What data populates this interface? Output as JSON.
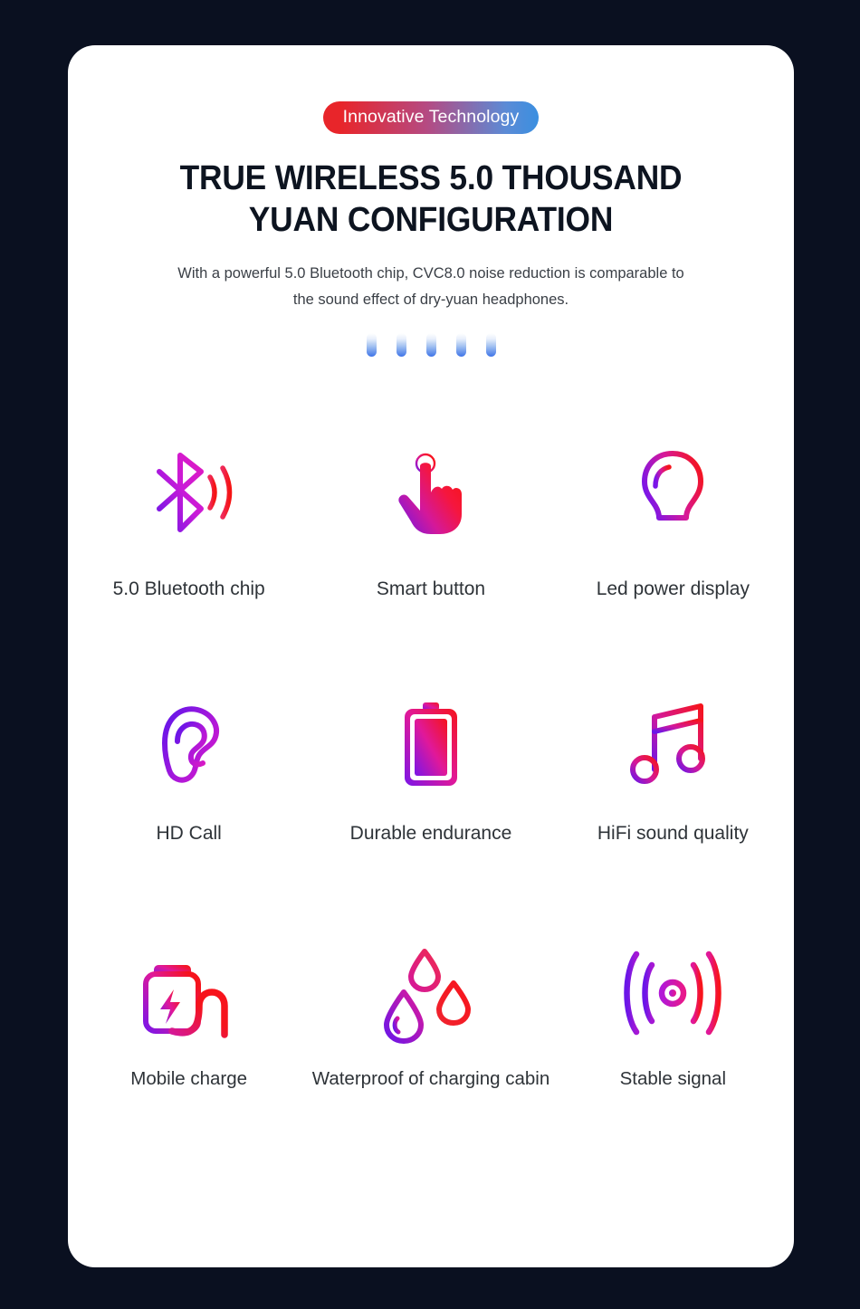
{
  "page": {
    "background_color": "#0a1020",
    "card_background": "#ffffff"
  },
  "badge": {
    "label": "Innovative Technology",
    "gradient_from": "#e8252a",
    "gradient_to": "#3a8fe0",
    "text_color": "#ffffff"
  },
  "headline": {
    "line1": "TRUE WIRELESS 5.0 THOUSAND",
    "line2": "YUAN CONFIGURATION",
    "color": "#0d1420"
  },
  "subcopy": {
    "text": "With a powerful 5.0 Bluetooth chip, CVC8.0 noise reduction is comparable to the sound effect of dry-yuan headphones.",
    "color": "#3a3f46"
  },
  "divider_bars": {
    "count": 5,
    "gradient_from": "#ffffff",
    "gradient_to": "#3f74e8"
  },
  "features": {
    "rows": [
      {
        "cells": [
          {
            "icon": "bluetooth-signal-icon",
            "label": "5.0 Bluetooth chip"
          },
          {
            "icon": "tap-hand-icon",
            "label": "Smart button"
          },
          {
            "icon": "lightbulb-icon",
            "label": "Led power display"
          }
        ]
      },
      {
        "cells": [
          {
            "icon": "ear-icon",
            "label": "HD Call"
          },
          {
            "icon": "battery-icon",
            "label": "Durable endurance"
          },
          {
            "icon": "music-note-icon",
            "label": "HiFi sound quality"
          }
        ]
      },
      {
        "cells": [
          {
            "icon": "power-bank-charging-icon",
            "label": "Mobile charge"
          },
          {
            "icon": "water-drops-icon",
            "label": "Waterproof of charging cabin"
          },
          {
            "icon": "radio-waves-icon",
            "label": "Stable signal"
          }
        ]
      }
    ],
    "accent_purple": "#7b1fe0",
    "accent_magenta": "#d61ad0",
    "accent_red": "#f01b1b",
    "label_color": "#2e3338"
  }
}
